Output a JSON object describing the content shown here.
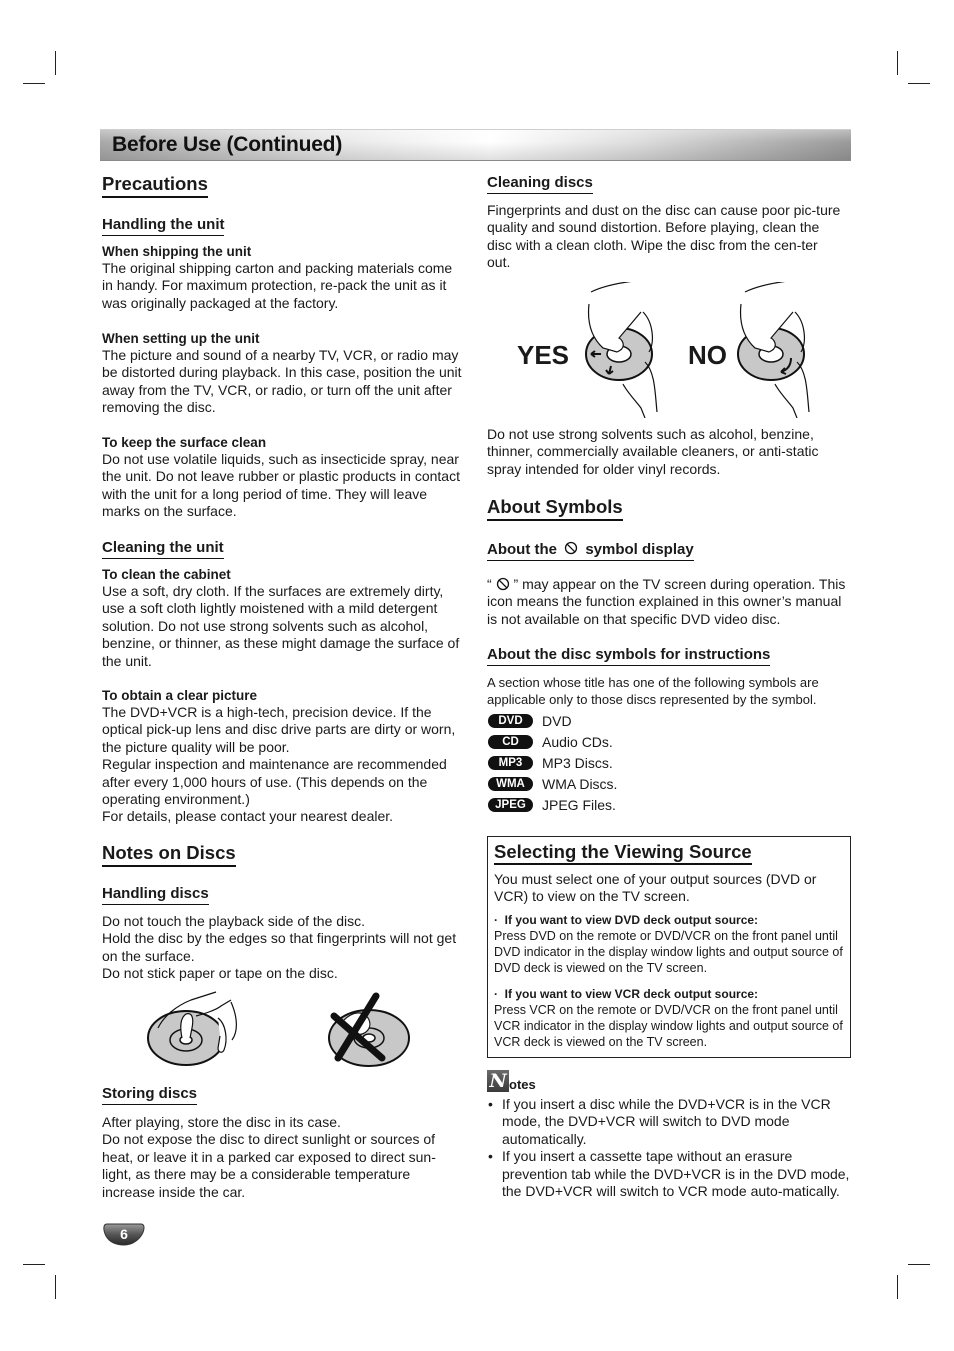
{
  "banner": {
    "title": "Before Use (Continued)"
  },
  "left": {
    "precautions": {
      "title": "Precautions",
      "handling_unit": {
        "title": "Handling the unit",
        "items": [
          {
            "heading": "When shipping the unit",
            "text": "The original shipping carton and packing materials come in handy. For maximum protection, re-pack the unit as it was originally packaged at the factory."
          },
          {
            "heading": "When setting  up the unit",
            "text": "The picture and sound of a nearby TV, VCR, or radio may be distorted during playback. In this case, position the unit away from the TV, VCR, or radio, or turn off the unit after removing the disc."
          },
          {
            "heading": "To keep the surface clean",
            "text": "Do not use volatile liquids, such as insecticide spray, near the unit. Do not leave rubber or plastic products in contact with the unit for a long period of time. They will leave marks on the surface."
          }
        ]
      },
      "cleaning_unit": {
        "title": "Cleaning the unit",
        "items": [
          {
            "heading": "To clean the cabinet",
            "text": "Use a soft, dry cloth. If the surfaces are extremely dirty, use a soft cloth lightly moistened with a mild detergent solution. Do not use strong solvents such as alcohol, benzine, or thinner, as these might damage the surface of the unit."
          },
          {
            "heading": "To obtain a clear picture",
            "lines": [
              "The DVD+VCR is a high-tech, precision device. If the optical pick-up lens and disc drive parts are dirty or worn, the picture quality will be poor.",
              "Regular inspection and maintenance are recommended after every 1,000 hours of use. (This depends on the operating environment.)",
              "For details, please contact your nearest dealer."
            ]
          }
        ]
      }
    },
    "notes_on_discs": {
      "title": "Notes on Discs",
      "handling_discs": {
        "title": "Handling discs",
        "lines": [
          "Do not touch the playback side of the disc.",
          "Hold the disc by the edges so that fingerprints will not get on the surface.",
          "Do not stick paper or tape on the disc."
        ]
      },
      "storing_discs": {
        "title": "Storing discs",
        "lines": [
          "After playing, store the disc in its case.",
          "Do not expose the disc to direct sunlight or sources of heat, or leave it in a parked car exposed to direct sun-light, as there may be a considerable temperature increase inside the car."
        ]
      }
    }
  },
  "right": {
    "cleaning_discs": {
      "title": "Cleaning discs",
      "text": "Fingerprints and dust on the disc can cause poor pic-ture quality and sound distortion. Before playing, clean the disc with a clean cloth. Wipe the disc from the cen-ter out.",
      "yes_label": "YES",
      "no_label": "NO",
      "warning": "Do not use strong solvents such as alcohol, benzine, thinner, commercially available cleaners, or anti-static spray intended for older vinyl records."
    },
    "about_symbols": {
      "title": "About Symbols",
      "symbol_display": {
        "title_before": "About the",
        "title_after": "symbol display",
        "text_open": "“",
        "text_rest": " ” may appear on the TV screen during operation. This icon means the function explained in this owner’s manual is not available on that specific DVD video disc."
      },
      "disc_symbols": {
        "title": "About the disc symbols for instructions",
        "text": "A section whose title has one of the following symbols are applicable only to those discs represented by the symbol.",
        "items": [
          {
            "badge": "DVD",
            "label": "DVD"
          },
          {
            "badge": "CD",
            "label": "Audio CDs."
          },
          {
            "badge": "MP3",
            "label": "MP3 Discs."
          },
          {
            "badge": "WMA",
            "label": "WMA Discs."
          },
          {
            "badge": "JPEG",
            "label": "JPEG Files."
          }
        ]
      }
    },
    "viewing_source": {
      "title": "Selecting the Viewing Source",
      "intro": "You must select one of your output sources (DVD or VCR) to view on the TV screen.",
      "bullets": [
        {
          "heading": "If you want to view DVD deck output source:",
          "text": "Press DVD on the remote or DVD/VCR on the front panel until DVD indicator in the display window lights and output source of DVD deck is viewed on the TV screen."
        },
        {
          "heading": "If you want to view VCR deck output source:",
          "text": "Press VCR on the remote or DVD/VCR on the front panel until VCR indicator in the display window lights and output source of VCR deck is viewed on the TV screen."
        }
      ]
    },
    "notes": {
      "icon_letter": "N",
      "title": "otes",
      "items": [
        "If you insert a disc while the DVD+VCR is in the VCR mode, the DVD+VCR will switch to DVD mode automatically.",
        "If you insert a cassette tape without an erasure prevention tab while the DVD+VCR is in the DVD mode, the DVD+VCR will switch to VCR mode auto-matically."
      ]
    }
  },
  "footer": {
    "page_number": "6"
  }
}
